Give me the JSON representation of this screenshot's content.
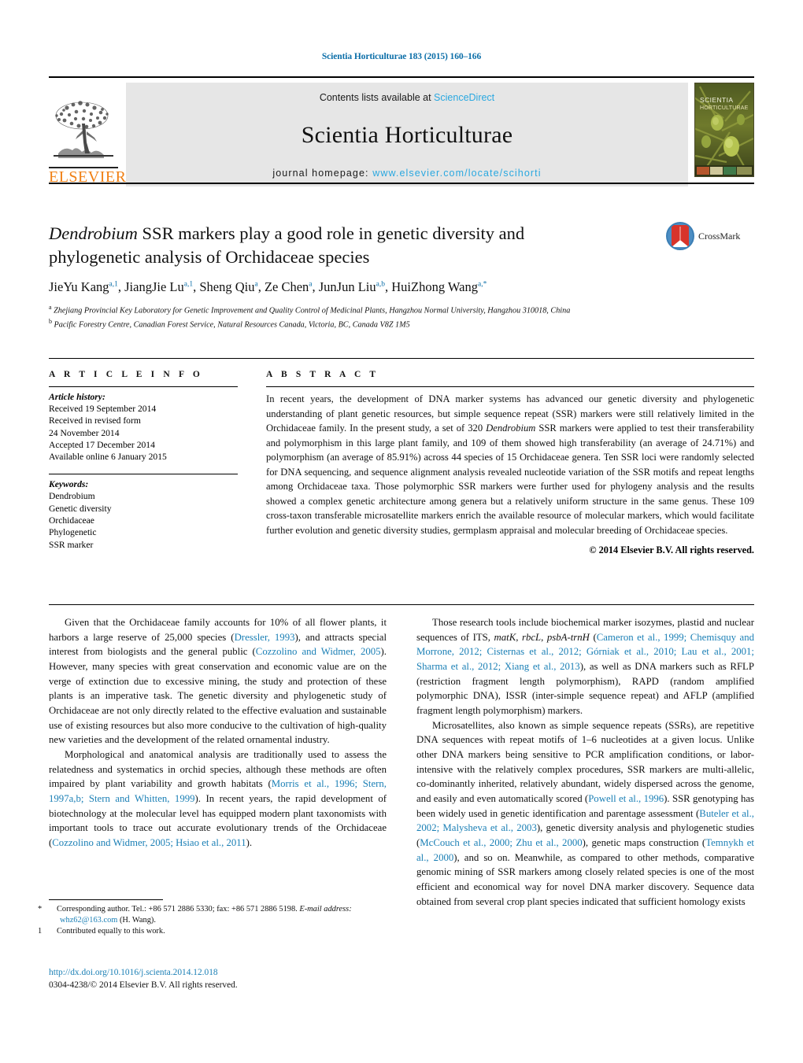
{
  "running_head": "Scientia Horticulturae 183 (2015) 160–166",
  "header": {
    "contents_prefix": "Contents lists available at ",
    "sciencedirect": "ScienceDirect",
    "journal_title": "Scientia Horticulturae",
    "homepage_prefix": "journal homepage:",
    "homepage_url": "www.elsevier.com/locate/scihorti",
    "publisher_logo_text": "ELSEVIER",
    "cover_title_line1": "SCIENTIA",
    "cover_title_line2": "HORTICULTURAE",
    "crossmark_label": "CrossMark",
    "link_color": "#2aa8e0",
    "elsevier_orange": "#f07f13"
  },
  "article": {
    "title_part1_italic": "Dendrobium",
    "title_rest": " SSR markers play a good role in genetic diversity and phylogenetic analysis of Orchidaceae species",
    "authors": "JieYu Kang, JiangJie Lu, Sheng Qiu, Ze Chen, JunJun Liu, HuiZhong Wang",
    "author_list": [
      {
        "name": "JieYu Kang",
        "marks": "a,1"
      },
      {
        "name": "JiangJie Lu",
        "marks": "a,1"
      },
      {
        "name": "Sheng Qiu",
        "marks": "a"
      },
      {
        "name": "Ze Chen",
        "marks": "a"
      },
      {
        "name": "JunJun Liu",
        "marks": "a,b"
      },
      {
        "name": "HuiZhong Wang",
        "marks": "a,*"
      }
    ],
    "affiliations": [
      {
        "mark": "a",
        "text": "Zhejiang Provincial Key Laboratory for Genetic Improvement and Quality Control of Medicinal Plants, Hangzhou Normal University, Hangzhou 310018, China"
      },
      {
        "mark": "b",
        "text": "Pacific Forestry Centre, Canadian Forest Service, Natural Resources Canada, Victoria, BC, Canada V8Z 1M5"
      }
    ]
  },
  "article_info": {
    "heading": "A R T I C L E  I N F O",
    "history_label": "Article history:",
    "history_lines": [
      "Received 19 September 2014",
      "Received in revised form",
      "24 November 2014",
      "Accepted 17 December 2014",
      "Available online 6 January 2015"
    ],
    "keywords_label": "Keywords:",
    "keywords": [
      "Dendrobium",
      "Genetic diversity",
      "Orchidaceae",
      "Phylogenetic",
      "SSR marker"
    ]
  },
  "abstract": {
    "heading": "A B S T R A C T",
    "text_before_italic": "In recent years, the development of DNA marker systems has advanced our genetic diversity and phylogenetic understanding of plant genetic resources, but simple sequence repeat (SSR) markers were still relatively limited in the Orchidaceae family. In the present study, a set of 320 ",
    "italic_term": "Dendrobium",
    "text_after_italic": " SSR markers were applied to test their transferability and polymorphism in this large plant family, and 109 of them showed high transferability (an average of 24.71%) and polymorphism (an average of 85.91%) across 44 species of 15 Orchidaceae genera. Ten SSR loci were randomly selected for DNA sequencing, and sequence alignment analysis revealed nucleotide variation of the SSR motifs and repeat lengths among Orchidaceae taxa. Those polymorphic SSR markers were further used for phylogeny analysis and the results showed a complex genetic architecture among genera but a relatively uniform structure in the same genus. These 109 cross-taxon transferable microsatellite markers enrich the available resource of molecular markers, which would facilitate further evolution and genetic diversity studies, germplasm appraisal and molecular breeding of Orchidaceae species.",
    "copyright": "© 2014 Elsevier B.V. All rights reserved."
  },
  "body": {
    "left_paragraphs": [
      {
        "segments": [
          {
            "t": "Given that the Orchidaceae family accounts for 10% of all flower plants, it harbors a large reserve of 25,000 species (",
            "k": "plain"
          },
          {
            "t": "Dressler, 1993",
            "k": "link"
          },
          {
            "t": "), and attracts special interest from biologists and the general public (",
            "k": "plain"
          },
          {
            "t": "Cozzolino and Widmer, 2005",
            "k": "link"
          },
          {
            "t": "). However, many species with great conservation and economic value are on the verge of extinction due to excessive mining, the study and protection of these plants is an imperative task. The genetic diversity and phylogenetic study of Orchidaceae are not only directly related to the effective evaluation and sustainable use of existing resources but also more conducive to the cultivation of high-quality new varieties and the development of the related ornamental industry.",
            "k": "plain"
          }
        ]
      },
      {
        "segments": [
          {
            "t": "Morphological and anatomical analysis are traditionally used to assess the relatedness and systematics in orchid species, although these methods are often impaired by plant variability and growth habitats (",
            "k": "plain"
          },
          {
            "t": "Morris et al., 1996; Stern, 1997a,b; Stern and Whitten, 1999",
            "k": "link"
          },
          {
            "t": "). In recent years, the rapid development of biotechnology at the molecular level has equipped modern plant taxonomists with important tools to trace out accurate evolutionary trends of the Orchidaceae (",
            "k": "plain"
          },
          {
            "t": "Cozzolino and Widmer, 2005; Hsiao et al., 2011",
            "k": "link"
          },
          {
            "t": ").",
            "k": "plain"
          }
        ]
      }
    ],
    "right_paragraphs": [
      {
        "segments": [
          {
            "t": "Those research tools include biochemical marker isozymes, plastid and nuclear sequences of ITS, ",
            "k": "plain"
          },
          {
            "t": "matK",
            "k": "italic"
          },
          {
            "t": ", ",
            "k": "plain"
          },
          {
            "t": "rbcL",
            "k": "italic"
          },
          {
            "t": ", ",
            "k": "plain"
          },
          {
            "t": "psbA-trnH",
            "k": "italic"
          },
          {
            "t": " (",
            "k": "plain"
          },
          {
            "t": "Cameron et al., 1999; Chemisquy and Morrone, 2012; Cisternas et al., 2012; Górniak et al., 2010; Lau et al., 2001; Sharma et al., 2012; Xiang et al., 2013",
            "k": "link"
          },
          {
            "t": "), as well as DNA markers such as RFLP (restriction fragment length polymorphism), RAPD (random amplified polymorphic DNA), ISSR (inter-simple sequence repeat) and AFLP (amplified fragment length polymorphism) markers.",
            "k": "plain"
          }
        ]
      },
      {
        "segments": [
          {
            "t": "Microsatellites, also known as simple sequence repeats (SSRs), are repetitive DNA sequences with repeat motifs of 1–6 nucleotides at a given locus. Unlike other DNA markers being sensitive to PCR amplification conditions, or labor-intensive with the relatively complex procedures, SSR markers are multi-allelic, co-dominantly inherited, relatively abundant, widely dispersed across the genome, and easily and even automatically scored (",
            "k": "plain"
          },
          {
            "t": "Powell et al., 1996",
            "k": "link"
          },
          {
            "t": "). SSR genotyping has been widely used in genetic identification and parentage assessment (",
            "k": "plain"
          },
          {
            "t": "Buteler et al., 2002; Malysheva et al., 2003",
            "k": "link"
          },
          {
            "t": "), genetic diversity analysis and phylogenetic studies (",
            "k": "plain"
          },
          {
            "t": "McCouch et al., 2000; Zhu et al., 2000",
            "k": "link"
          },
          {
            "t": "), genetic maps construction (",
            "k": "plain"
          },
          {
            "t": "Temnykh et al., 2000",
            "k": "link"
          },
          {
            "t": "), and so on. Meanwhile, as compared to other methods, comparative genomic mining of SSR markers among closely related species is one of the most efficient and economical way for novel DNA marker discovery. Sequence data obtained from several crop plant species indicated that sufficient homology exists",
            "k": "plain"
          }
        ]
      }
    ]
  },
  "footnotes": {
    "corresponding": {
      "mark": "*",
      "text": "Corresponding author. Tel.: +86 571 2886 5330; fax: +86 571 2886 5198.",
      "email_label": "E-mail address:",
      "email": "whz62@163.com",
      "email_suffix": "(H. Wang)."
    },
    "equal_contrib": {
      "mark": "1",
      "text": "Contributed equally to this work."
    }
  },
  "footer": {
    "doi": "http://dx.doi.org/10.1016/j.scienta.2014.12.018",
    "issn_copyright": "0304-4238/© 2014 Elsevier B.V. All rights reserved."
  }
}
